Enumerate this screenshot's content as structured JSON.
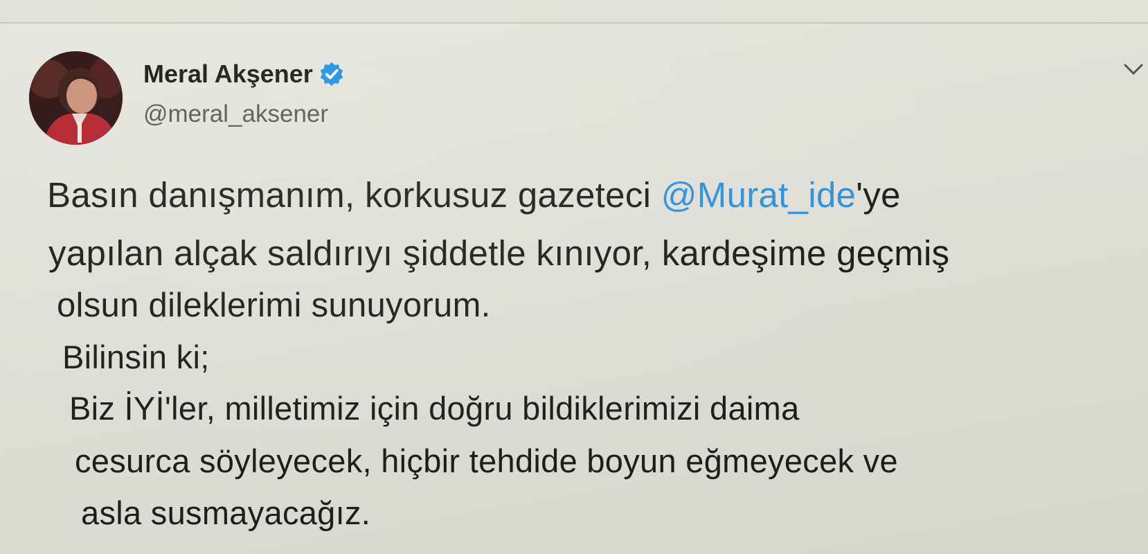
{
  "tweet": {
    "author": {
      "display_name": "Meral Akşener",
      "handle": "@meral_aksener",
      "verified_icon": "verified-badge-icon"
    },
    "menu_icon": "chevron-down-icon",
    "text_lines": [
      {
        "before": "Basın danışmanım, korkusuz gazeteci ",
        "mention": "@Murat_ide",
        "after": "'ye"
      },
      {
        "text": "yapılan alçak saldırıyı şiddetle kınıyor, kardeşime geçmiş"
      },
      {
        "text": "olsun dileklerimi sunuyorum."
      },
      {
        "text": "Bilinsin ki;"
      },
      {
        "text": "Biz İYİ'ler, milletimiz için doğru bildiklerimizi daima"
      },
      {
        "text": "cesurca söyleyecek, hiçbir tehdide boyun eğmeyecek ve"
      },
      {
        "text": "asla susmayacağız."
      }
    ]
  },
  "colors": {
    "mention": "#2f8fd6",
    "verified": "#1d8fe0",
    "background": "#dfdfd8",
    "text": "#1d1d1d"
  }
}
